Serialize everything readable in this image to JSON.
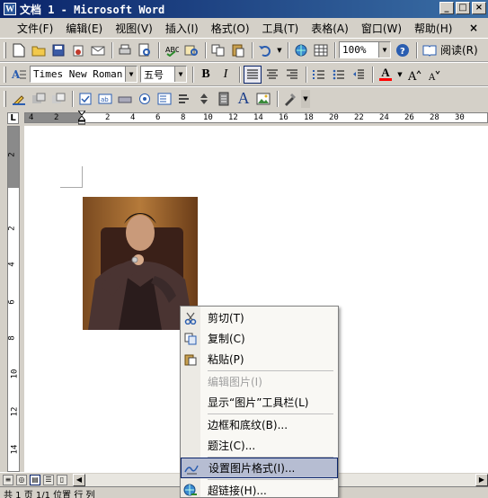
{
  "window": {
    "title": "文档 1 - Microsoft Word",
    "app_icon_label": "W",
    "min_label": "_",
    "max_label": "□",
    "close_label": "×"
  },
  "menubar": {
    "items": [
      {
        "label": "文件(F)"
      },
      {
        "label": "编辑(E)"
      },
      {
        "label": "视图(V)"
      },
      {
        "label": "插入(I)"
      },
      {
        "label": "格式(O)"
      },
      {
        "label": "工具(T)"
      },
      {
        "label": "表格(A)"
      },
      {
        "label": "窗口(W)"
      },
      {
        "label": "帮助(H)"
      }
    ],
    "close_doc_label": "×"
  },
  "standard_toolbar": {
    "zoom_value": "100%",
    "reading_label": "阅读(R)"
  },
  "format_toolbar": {
    "font_name": "Times New Roman",
    "font_size": "五号",
    "bold_label": "B",
    "italic_label": "I",
    "font_color_label": "A"
  },
  "forms_toolbar": {
    "text_label": "A"
  },
  "ruler": {
    "h_numbers": [
      "4",
      "2",
      "2",
      "4",
      "6",
      "8",
      "10",
      "12",
      "14",
      "16",
      "18",
      "20",
      "22",
      "24",
      "26",
      "28",
      "30"
    ],
    "v_numbers": [
      "2",
      "2",
      "4",
      "6",
      "8",
      "10",
      "12",
      "14"
    ]
  },
  "status_bar": {
    "text": "共 1 页  1/1  位置  行  列"
  },
  "context_menu": {
    "items": [
      {
        "label": "剪切(T)",
        "icon": "scissors-icon",
        "glyph": "✂",
        "enabled": true,
        "highlighted": false
      },
      {
        "label": "复制(C)",
        "icon": "copy-icon",
        "glyph": "❐",
        "enabled": true,
        "highlighted": false
      },
      {
        "label": "粘贴(P)",
        "icon": "paste-icon",
        "glyph": "📋",
        "enabled": true,
        "highlighted": false
      },
      {
        "label": "编辑图片(I)",
        "icon": "",
        "glyph": "",
        "enabled": false,
        "highlighted": false
      },
      {
        "label": "显示“图片”工具栏(L)",
        "icon": "",
        "glyph": "",
        "enabled": true,
        "highlighted": false
      },
      {
        "label": "边框和底纹(B)...",
        "icon": "",
        "glyph": "",
        "enabled": true,
        "highlighted": false
      },
      {
        "label": "题注(C)...",
        "icon": "",
        "glyph": "",
        "enabled": true,
        "highlighted": false
      },
      {
        "label": "设置图片格式(I)...",
        "icon": "format-picture-icon",
        "glyph": "✎",
        "enabled": true,
        "highlighted": true
      },
      {
        "label": "超链接(H)...",
        "icon": "hyperlink-icon",
        "glyph": "🌐",
        "enabled": true,
        "highlighted": false
      }
    ]
  },
  "colors": {
    "title_bar": "#0a246a",
    "chrome": "#d4d0c8",
    "menu_highlight": "#b6bdd2",
    "font_color_red": "#ff0000"
  }
}
